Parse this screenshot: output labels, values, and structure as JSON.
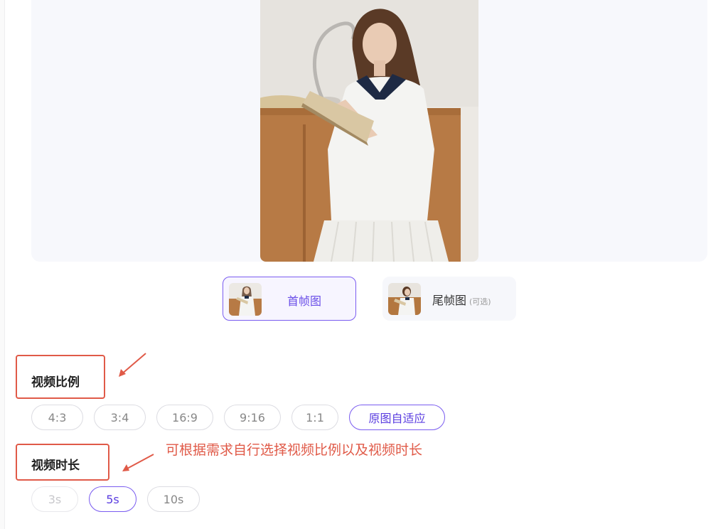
{
  "frames": {
    "first": {
      "label": "首帧图"
    },
    "last": {
      "label": "尾帧图",
      "optional": "(可选)"
    }
  },
  "ratio": {
    "title": "视频比例",
    "options": [
      "4:3",
      "3:4",
      "16:9",
      "9:16",
      "1:1",
      "原图自适应"
    ],
    "selected": "原图自适应"
  },
  "duration": {
    "title": "视频时长",
    "options": [
      "3s",
      "5s",
      "10s"
    ],
    "selected": "5s",
    "disabled": "3s"
  },
  "annotation": "可根据需求自行选择视频比例以及视频时长",
  "colors": {
    "accent": "#7a5cf0",
    "annotation_red": "#e05a48"
  }
}
